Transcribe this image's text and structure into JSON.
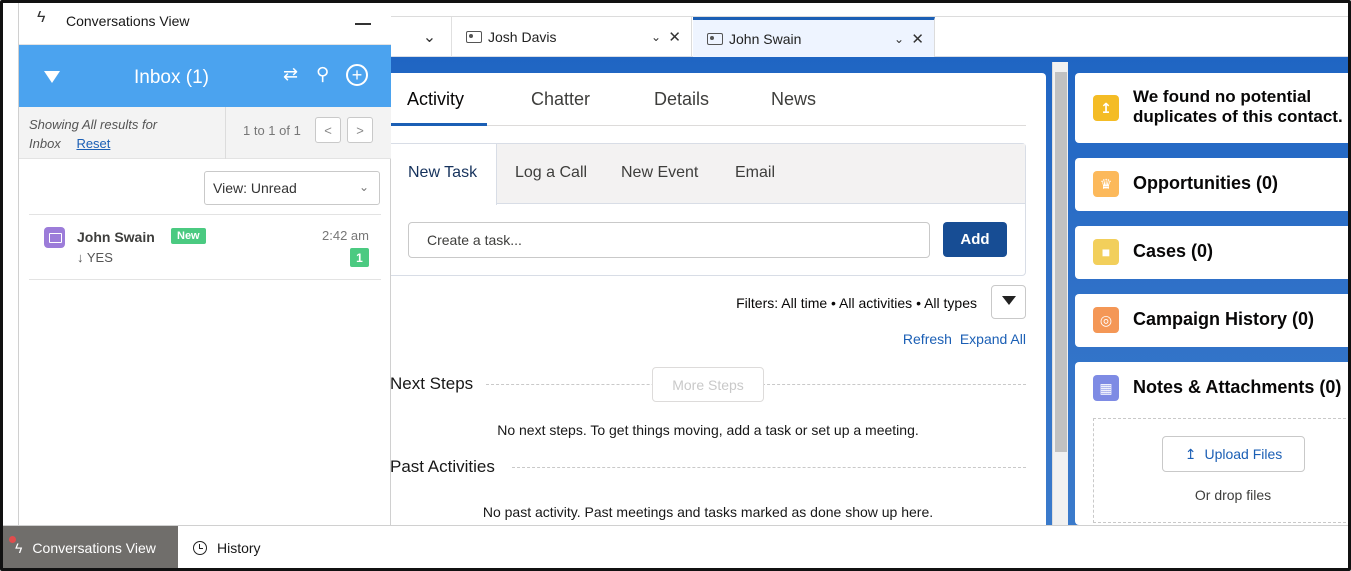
{
  "conversations": {
    "header_title": "Conversations View",
    "inbox_title": "Inbox (1)",
    "showing_text": "Showing All results for",
    "showing_scope": "Inbox",
    "reset_label": "Reset",
    "pagination": "1 to 1 of 1",
    "view_select": "View: Unread",
    "items": [
      {
        "name": "John Swain",
        "badge": "New",
        "time": "2:42 am",
        "message": "YES",
        "count": "1"
      }
    ]
  },
  "tabs": [
    {
      "label": "Josh Davis"
    },
    {
      "label": "John Swain"
    }
  ],
  "record": {
    "subtabs": [
      "Activity",
      "Chatter",
      "Details",
      "News"
    ],
    "composer_tabs": [
      "New Task",
      "Log a Call",
      "New Event",
      "Email"
    ],
    "task_placeholder": "Create a task...",
    "add_label": "Add",
    "filters_text": "Filters: All time • All activities • All types",
    "refresh_label": "Refresh",
    "expand_label": "Expand All",
    "next_steps_title": "Next Steps",
    "more_steps_label": "More Steps",
    "next_steps_empty": "No next steps. To get things moving, add a task or set up a meeting.",
    "past_title": "Past Activities",
    "past_empty": "No past activity. Past meetings and tasks marked as done show up here."
  },
  "related": {
    "duplicates": "We found no potential duplicates of this contact.",
    "opportunities": "Opportunities (0)",
    "cases": "Cases (0)",
    "campaign": "Campaign History (0)",
    "notes": "Notes & Attachments (0)",
    "upload_label": "Upload Files",
    "drop_text": "Or drop files"
  },
  "utility": {
    "conversations_label": "Conversations View",
    "history_label": "History"
  },
  "colors": {
    "brand_blue": "#1b5fb5",
    "inbox_blue": "#4ba3ef",
    "success_green": "#4bca81",
    "add_button": "#174d94"
  }
}
